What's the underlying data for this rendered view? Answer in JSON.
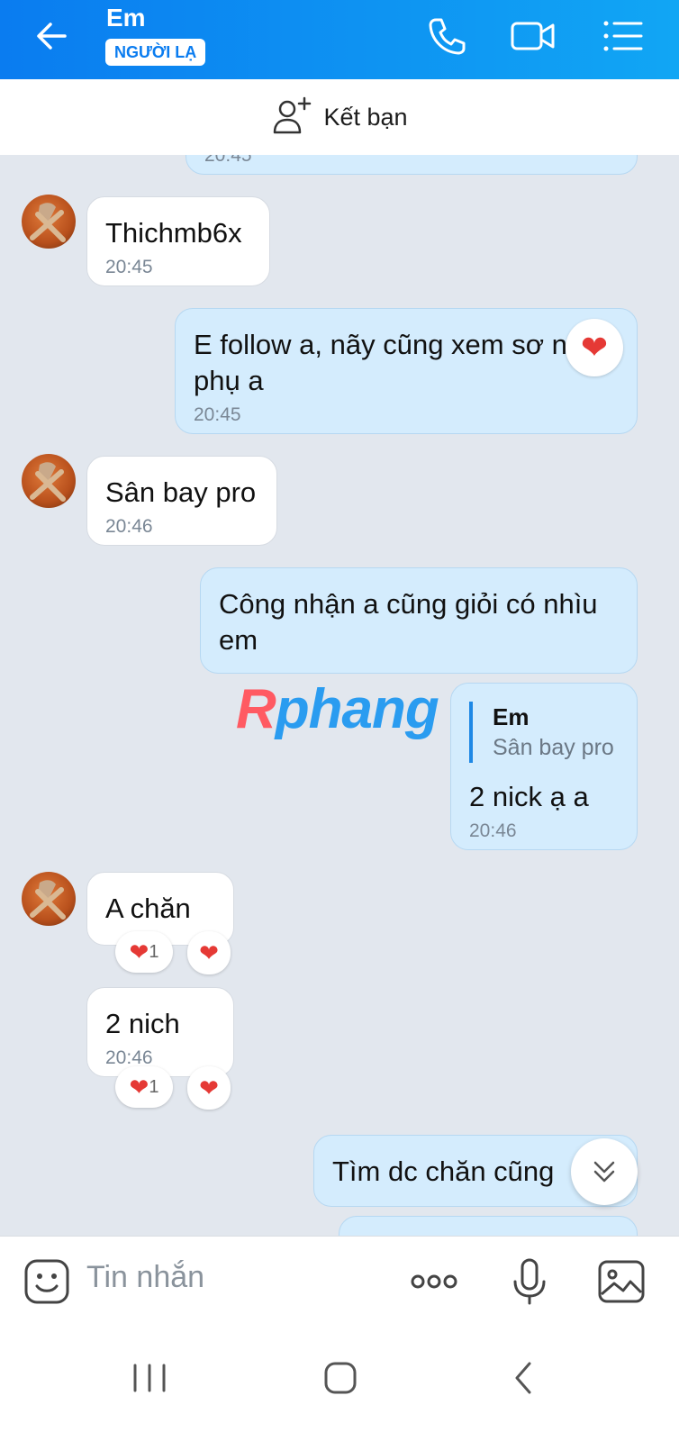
{
  "header": {
    "contact_name": "Em",
    "badge": "NGƯỜI LẠ",
    "icons": [
      "back-arrow-icon",
      "phone-icon",
      "video-call-icon",
      "menu-list-icon"
    ]
  },
  "add_friend": {
    "label": "Kết bạn",
    "icon": "add-user-icon"
  },
  "messages": {
    "m0_time": "20:45",
    "m1_text": "Thichmb6x",
    "m1_time": "20:45",
    "m2_line1": "E follow a, nãy cũng xem sơ n",
    "m2_line2": "phụ a",
    "m2_time": "20:45",
    "m3_text": "Sân bay pro",
    "m3_time": "20:46",
    "m4_line1": "Công nhận a cũng giỏi có nhìu",
    "m4_line2": "em",
    "m5_quote_name": "Em",
    "m5_quote_text": "Sân bay pro",
    "m5_text": "2 nick ạ a",
    "m5_time": "20:46",
    "m6_text": "A chăn",
    "m6_react_count": "1",
    "m7_text": "2 nich",
    "m7_time": "20:46",
    "m7_react_count": "1",
    "m8_text": "Tìm dc chăn cũng"
  },
  "watermark": {
    "part1": "R",
    "part2": "phang"
  },
  "input": {
    "placeholder": "Tin nhắn"
  },
  "colors": {
    "header_start": "#0a7cf0",
    "header_end": "#11a6f4",
    "outgoing_bubble": "#d4ecfd",
    "chat_bg": "#e2e7ee",
    "heart": "#e53935"
  }
}
